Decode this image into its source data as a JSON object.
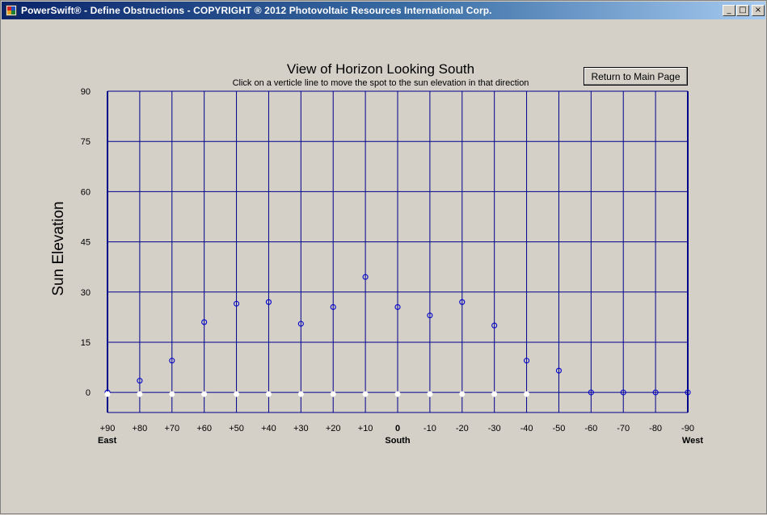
{
  "window": {
    "title": "PowerSwift® - Define Obstructions -  COPYRIGHT ® 2012 Photovoltaic Resources International Corp.",
    "minimize_glyph": "_",
    "maximize_glyph": "□",
    "close_glyph": "×"
  },
  "header": {
    "title": "View of Horizon Looking South",
    "subtitle": "Click on a verticle line to move the spot to the sun elevation in that direction",
    "return_button": "Return to Main Page"
  },
  "colors": {
    "grid": "#00008b",
    "marker": "#0000cd",
    "window_bg": "#d4d0c8"
  },
  "chart_data": {
    "type": "scatter",
    "title": "View of Horizon Looking South",
    "subtitle": "Click on a verticle line to move the spot to the sun elevation in that direction",
    "ylabel": "Sun Elevation",
    "ylim": [
      -6,
      90
    ],
    "yticks": [
      90,
      75,
      60,
      45,
      30,
      15,
      0
    ],
    "xlim": [
      90,
      -90
    ],
    "x": [
      90,
      80,
      70,
      60,
      50,
      40,
      30,
      20,
      10,
      0,
      -10,
      -20,
      -30,
      -40,
      -50,
      -60,
      -70,
      -80,
      -90
    ],
    "xtick_labels": [
      "+90",
      "+80",
      "+70",
      "+60",
      "+50",
      "+40",
      "+30",
      "+20",
      "+10",
      "0",
      "-10",
      "-20",
      "-30",
      "-40",
      "-50",
      "-60",
      "-70",
      "-80",
      "-90"
    ],
    "direction_labels": [
      {
        "x": 90,
        "label": "East"
      },
      {
        "x": 0,
        "label": "South"
      },
      {
        "x": -90,
        "label": "West"
      }
    ],
    "grid": true,
    "series": [
      {
        "values": [
          0,
          3.5,
          9.5,
          21,
          26.5,
          27,
          20.5,
          25.5,
          34.5,
          25.5,
          23,
          27,
          20,
          9.5,
          6.5,
          0,
          0,
          0,
          0
        ],
        "marker": "open-circle"
      },
      {
        "values": [
          -0.5,
          -0.5,
          -0.5,
          -0.5,
          -0.5,
          -0.5,
          -0.5,
          -0.5,
          -0.5,
          -0.5,
          -0.5,
          -0.5,
          -0.5,
          -0.5,
          null,
          null,
          null,
          null,
          null
        ],
        "marker": "white-circle"
      }
    ]
  }
}
